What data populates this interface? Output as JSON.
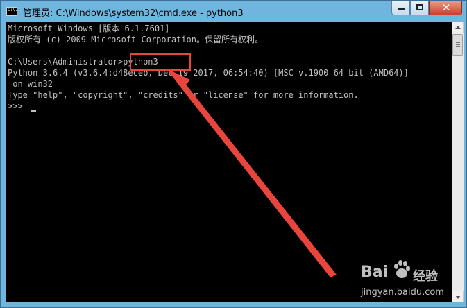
{
  "window": {
    "title": "管理员: C:\\Windows\\system32\\cmd.exe - python3",
    "app_icon_text": "C:\\.",
    "close_glyph": "✕"
  },
  "console": {
    "lines": [
      "Microsoft Windows [版本 6.1.7601]",
      "版权所有 (c) 2009 Microsoft Corporation。保留所有权利。",
      "",
      "C:\\Users\\Administrator>python3",
      "Python 3.6.4 (v3.6.4:d48eceb, Dec 19 2017, 06:54:40) [MSC v.1900 64 bit (AMD64)]",
      " on win32",
      "Type \"help\", \"copyright\", \"credits\" or \"license\" for more information.",
      ">>> "
    ]
  },
  "annotation": {
    "highlight_color": "#e8453c",
    "arrow_color": "#e8453c"
  },
  "watermark": {
    "logo_text": "Bai",
    "logo_suffix": "经验",
    "url": "jingyan.baidu.com"
  }
}
